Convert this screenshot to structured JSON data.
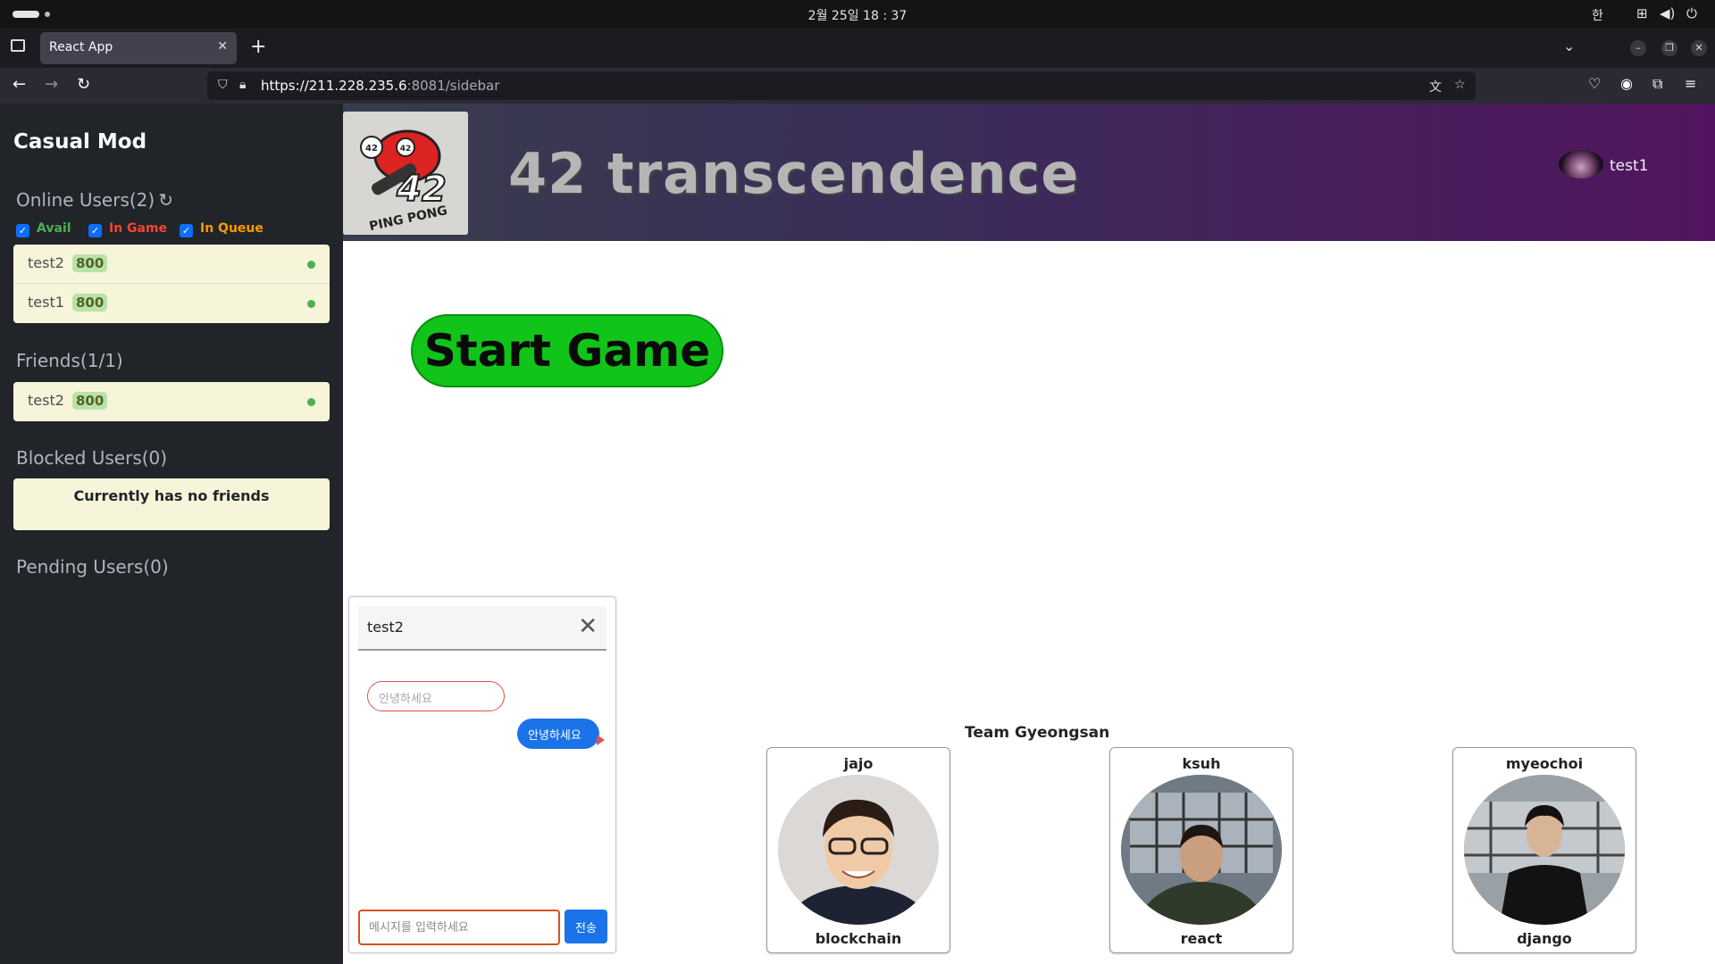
{
  "os": {
    "clock": "2월 25일  18 : 37",
    "ime": "한"
  },
  "browser": {
    "tab_title": "React App",
    "url_host": "https://211.228.235.6",
    "url_rest": ":8081/sidebar"
  },
  "sidebar": {
    "title": "Casual Mod",
    "online": {
      "label": "Online Users(2)",
      "filters": [
        {
          "label": "Avail",
          "color": "#4caf50"
        },
        {
          "label": "In Game",
          "color": "#f44336"
        },
        {
          "label": "In Queue",
          "color": "#ff9800"
        }
      ],
      "users": [
        {
          "name": "test2",
          "rating": "800"
        },
        {
          "name": "test1",
          "rating": "800"
        }
      ]
    },
    "friends": {
      "label": "Friends(1/1)",
      "users": [
        {
          "name": "test2",
          "rating": "800"
        }
      ]
    },
    "blocked": {
      "label": "Blocked Users(0)",
      "empty_text": "Currently has no friends"
    },
    "pending": {
      "label": "Pending Users(0)"
    }
  },
  "header": {
    "title": "42 transcendence",
    "username": "test1",
    "logo": {
      "badge_left": "42",
      "badge_right": "42",
      "big_text": "42",
      "caption": "PING PONG"
    }
  },
  "main": {
    "start_label": "Start Game"
  },
  "chat": {
    "partner": "test2",
    "messages": [
      {
        "text": "안녕하세요",
        "from": "partner"
      },
      {
        "text": "안녕하세요",
        "from": "me"
      }
    ],
    "input_placeholder": "메시지를 입력하세요",
    "send_label": "전송"
  },
  "team": {
    "title": "Team Gyeongsan",
    "members": [
      {
        "name": "jajo",
        "role": "blockchain"
      },
      {
        "name": "ksuh",
        "role": "react"
      },
      {
        "name": "myeochoi",
        "role": "django"
      }
    ]
  }
}
